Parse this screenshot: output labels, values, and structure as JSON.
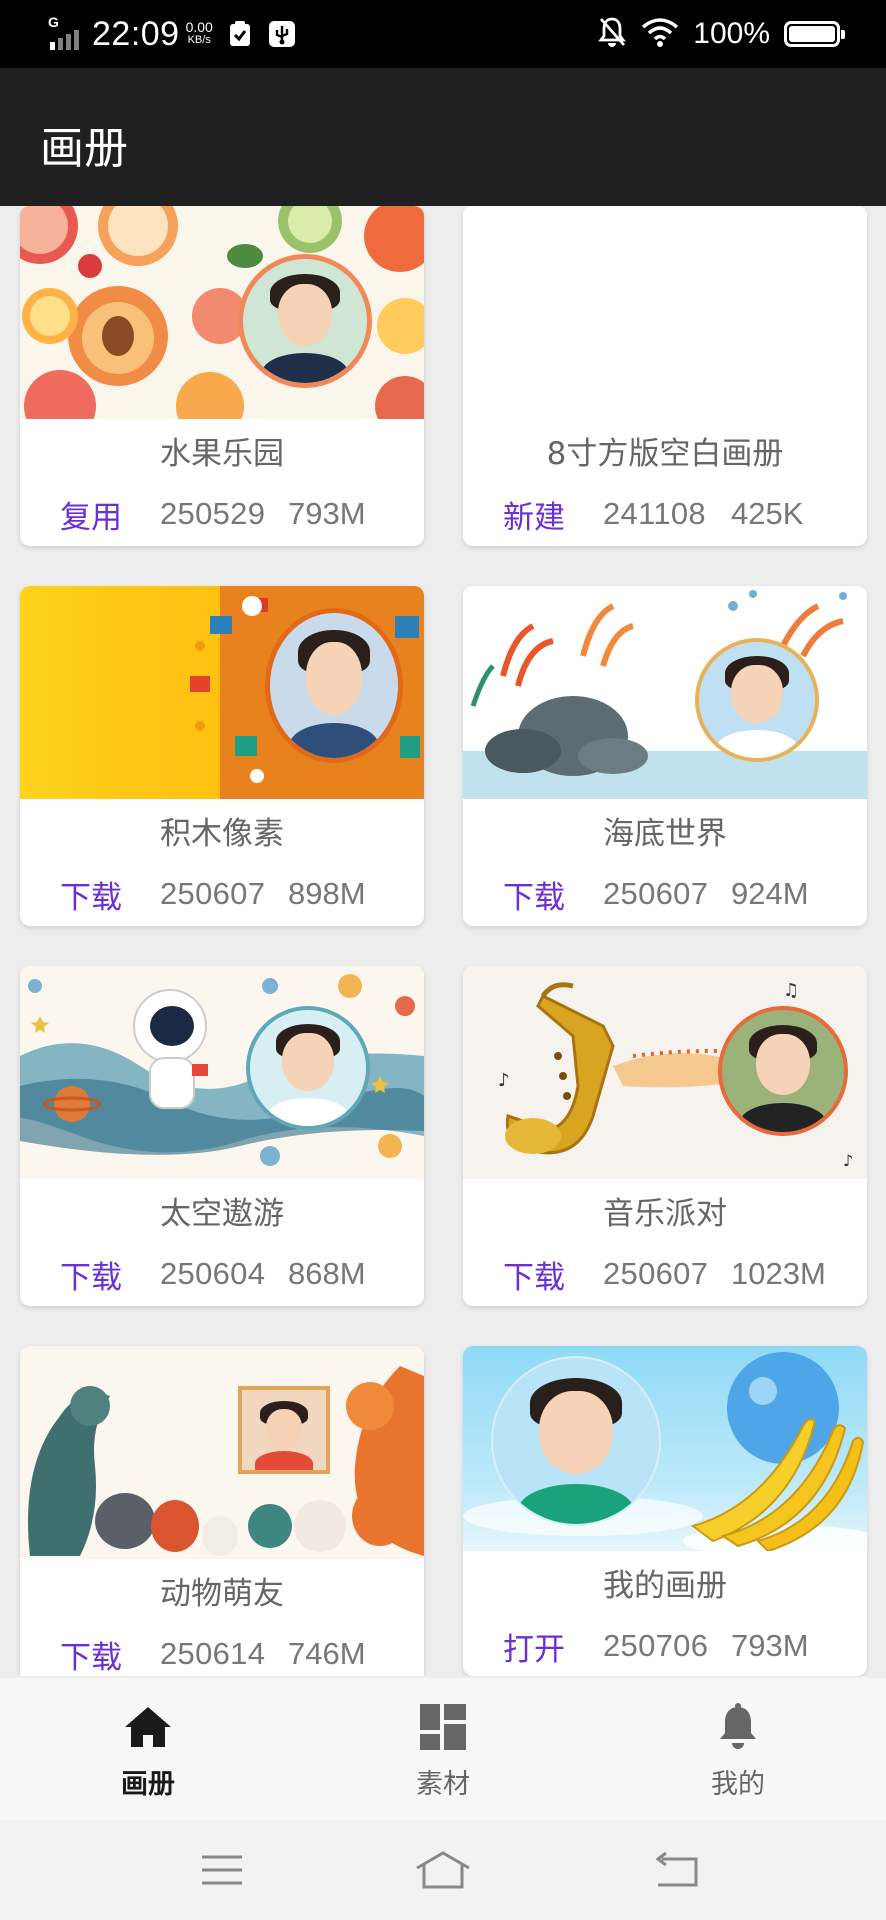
{
  "status_bar": {
    "network": "G",
    "time": "22:09",
    "speed_value": "0.00",
    "speed_unit": "KB/s",
    "battery": "100%"
  },
  "app_bar": {
    "title": "画册"
  },
  "albums": [
    {
      "title": "水果乐园",
      "action": "复用",
      "date": "250529",
      "size": "793M"
    },
    {
      "title": "8寸方版空白画册",
      "action": "新建",
      "date": "241108",
      "size": "425K"
    },
    {
      "title": "积木像素",
      "action": "下载",
      "date": "250607",
      "size": "898M"
    },
    {
      "title": "海底世界",
      "action": "下载",
      "date": "250607",
      "size": "924M"
    },
    {
      "title": "太空遨游",
      "action": "下载",
      "date": "250604",
      "size": "868M"
    },
    {
      "title": "音乐派对",
      "action": "下载",
      "date": "250607",
      "size": "1023M"
    },
    {
      "title": "动物萌友",
      "action": "下载",
      "date": "250614",
      "size": "746M"
    },
    {
      "title": "我的画册",
      "action": "打开",
      "date": "250706",
      "size": "793M"
    }
  ],
  "bottom_nav": [
    {
      "label": "画册",
      "icon": "home-icon",
      "active": true
    },
    {
      "label": "素材",
      "icon": "dashboard-icon",
      "active": false
    },
    {
      "label": "我的",
      "icon": "bell-icon",
      "active": false
    }
  ],
  "colors": {
    "accent": "#6b2fd6",
    "app_bar": "#202020",
    "active_nav": "#1a1a1a",
    "inactive_nav": "#666666"
  }
}
